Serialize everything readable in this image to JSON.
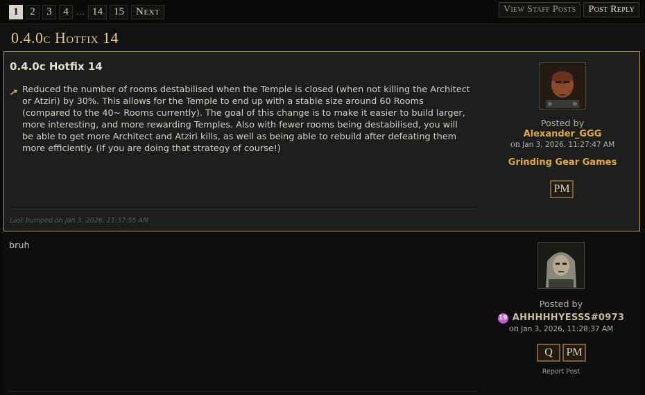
{
  "pagination": {
    "pages": [
      "1",
      "2",
      "3",
      "4",
      "…",
      "14",
      "15"
    ],
    "current": "1",
    "next_label": "Next"
  },
  "toolbar": {
    "view_staff_label": "View Staff Posts",
    "post_reply_label": "Post Reply"
  },
  "thread": {
    "title": "0.4.0c Hotfix 14"
  },
  "post1": {
    "title": "0.4.0c Hotfix 14",
    "bullet_text": "Reduced the number of rooms destabilised when the Temple is closed (when not killing the Architect or Atziri) by 30%. This allows for the Temple to end up with a stable size around 60 Rooms (compared to the 40~ Rooms currently). The goal of this change is to make it easier to build larger, more interesting, and more rewarding Temples. Also with fewer rooms being destabilised, you will be able to get more Architect and Atziri kills, as well as being able to rebuild after defeating them more efficiently. (If you are doing that strategy of course!)",
    "last_bumped": "Last bumped on Jan 3, 2026, 11:37:55 AM",
    "author": {
      "posted_by": "Posted by",
      "name": "Alexander_GGG",
      "on": "on",
      "date": "Jan 3, 2026, 11:27:47 AM",
      "company": "Grinding Gear Games",
      "pm_label": "PM"
    }
  },
  "post2": {
    "text": "bruh",
    "author": {
      "posted_by": "Posted by",
      "level": "19",
      "name": "AHHHHHYESSS#0973",
      "on": "on",
      "date": "Jan 3, 2026, 11:28:37 AM",
      "quote_label": "Q",
      "pm_label": "PM",
      "report_label": "Report Post"
    }
  }
}
